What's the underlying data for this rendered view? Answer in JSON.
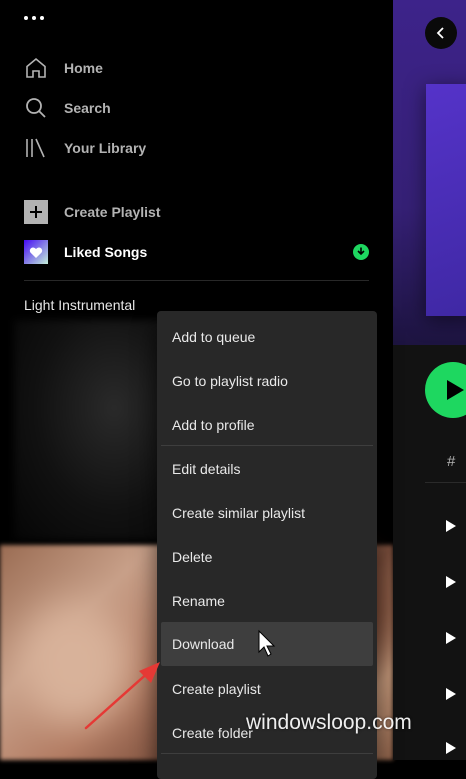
{
  "sidebar": {
    "nav": [
      {
        "label": "Home",
        "icon": "home-icon"
      },
      {
        "label": "Search",
        "icon": "search-icon"
      },
      {
        "label": "Your Library",
        "icon": "library-icon"
      }
    ],
    "create_playlist": "Create Playlist",
    "liked_songs": "Liked Songs",
    "playlist_title": "Light Instrumental"
  },
  "main": {
    "column_hash": "#"
  },
  "context_menu": {
    "items": [
      "Add to queue",
      "Go to playlist radio",
      "Add to profile",
      "Edit details",
      "Create similar playlist",
      "Delete",
      "Rename",
      "Download",
      "Create playlist",
      "Create folder"
    ],
    "highlighted": "Download"
  },
  "watermark": "windowsloop.com",
  "colors": {
    "accent_green": "#1ed760",
    "menu_bg": "#282828",
    "highlight": "#3e3e3e",
    "arrow_red": "#e53935"
  }
}
